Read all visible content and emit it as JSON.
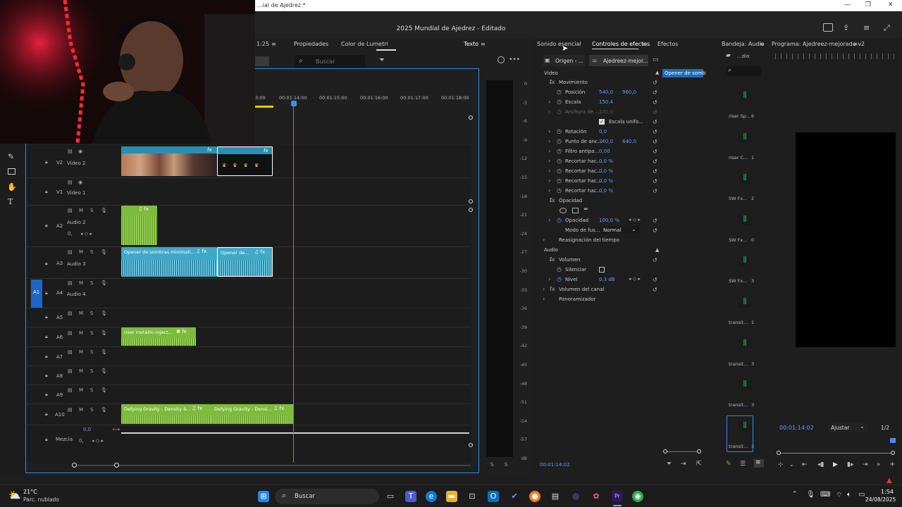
{
  "window": {
    "title": "...ial de Ajedrez *",
    "app_title": "2025 Mundial de Ajedrez - Editado"
  },
  "timeline_panel": {
    "tabs": [
      "Propiedades",
      "Color de Lumetri",
      "Texto"
    ],
    "timecode_fragment": "1:25",
    "search_placeholder": "Buscar",
    "ruler": [
      "3:00",
      "00:01:14:00",
      "00:01:15:00",
      "00:01:16:00",
      "00:01:17:00",
      "00:01:18:00"
    ],
    "mix_value": "0,0",
    "tracks": [
      {
        "id": "V2",
        "name": "Vídeo 2"
      },
      {
        "id": "V1",
        "name": "Vídeo 1"
      },
      {
        "id": "A2",
        "name": "Audio 2"
      },
      {
        "id": "A3",
        "name": "Audio 3"
      },
      {
        "id": "A4",
        "name": "Audio 4",
        "source": "A1"
      },
      {
        "id": "A5",
        "name": ""
      },
      {
        "id": "A6",
        "name": ""
      },
      {
        "id": "A7",
        "name": ""
      },
      {
        "id": "A8",
        "name": ""
      },
      {
        "id": "A9",
        "name": ""
      },
      {
        "id": "A10",
        "name": ""
      },
      {
        "id": "",
        "name": "Mezcla"
      }
    ],
    "clips": {
      "a3_clip1": "Opener de sombras minimali...",
      "a3_clip2": "Opener de...",
      "a6_clip": "riser metallic-inject...",
      "a10_clip1": "Defying Gravity - Density &...",
      "a10_clip2": "Defying Gravity - Densi..."
    },
    "meter_ticks": [
      "0",
      "-3",
      "-6",
      "-9",
      "-12",
      "-15",
      "-18",
      "-21",
      "-24",
      "-27",
      "-30",
      "-33",
      "-36",
      "-39",
      "-42",
      "-45",
      "-48",
      "-51",
      "-54",
      "-57",
      "dB"
    ],
    "meter_bottom": [
      "S",
      "S"
    ]
  },
  "effects_panel": {
    "tabs": [
      "Sonido esencial",
      "Controles de efectos",
      "Efectos"
    ],
    "source_label": "Origen - ...",
    "sequence_label": "Ajedreez-mejor...",
    "clip_tooltip": "Opener de somb",
    "timecode": "00:01:14:02",
    "section_video": "Vídeo",
    "section_audio": "Audio",
    "rows": {
      "movimiento": "Movimiento",
      "posicion": "Posición",
      "posicion_x": "540,0",
      "posicion_y": "960,0",
      "escala": "Escala",
      "escala_v": "150,4",
      "anchura": "Anchura de ...",
      "anchura_v": "100,0",
      "escala_unif": "Escala unifo...",
      "rotacion": "Rotación",
      "rotacion_v": "0,0",
      "punto": "Punto de anc...",
      "punto_x": "360,0",
      "punto_y": "640,0",
      "filtro": "Filtro antipa...",
      "filtro_v": "0,00",
      "recortar1": "Recortar hac...",
      "recortar1_v": "0,0 %",
      "recortar2": "Recortar hac...",
      "recortar2_v": "0,0 %",
      "recortar3": "Recortar hac...",
      "recortar3_v": "0,0 %",
      "recortar4": "Recortar hac...",
      "recortar4_v": "0,0 %",
      "opacidad_h": "Opacidad",
      "opacidad": "Opacidad",
      "opacidad_v": "100,0 %",
      "modo": "Modo de fus...",
      "modo_v": "Normal",
      "reasignacion": "Reasignación del tiempo",
      "volumen": "Volumen",
      "silenciar": "Silenciar",
      "nivel": "Nivel",
      "nivel_v": "0,3 dB",
      "volumen_canal": "Volumen del canal",
      "panoramizador": "Panoramizador"
    }
  },
  "bin_panel": {
    "title": "Bandeja: Audio",
    "sub": "...dio",
    "items": [
      {
        "label": "riser Sp...",
        "count": "6"
      },
      {
        "label": "riser C...",
        "count": "1"
      },
      {
        "label": "SW Fx...",
        "count": "2"
      },
      {
        "label": "SW Fx...",
        "count": "0"
      },
      {
        "label": "SW Fx...",
        "count": "3"
      },
      {
        "label": "transit...",
        "count": "1"
      },
      {
        "label": "transit...",
        "count": "3"
      },
      {
        "label": "transit...",
        "count": "3"
      },
      {
        "label": "transit...",
        "count": "3"
      }
    ]
  },
  "program_panel": {
    "title": "Programa: Ajedreez-mejorada-v2",
    "timecode": "00:01:14:02",
    "fit": "Ajustar",
    "ratio": "1/2"
  },
  "taskbar": {
    "weather_temp": "21°C",
    "weather_desc": "Parc. nublado",
    "search": "Buscar",
    "time": "1:54",
    "date": "24/08/2025"
  },
  "colors": {
    "accent": "#2d8ceb",
    "audio_clip": "#3fa9c7",
    "green_clip": "#7dbb3c",
    "video_clip": "#2a8fb0",
    "value_blue": "#5a9fff"
  }
}
